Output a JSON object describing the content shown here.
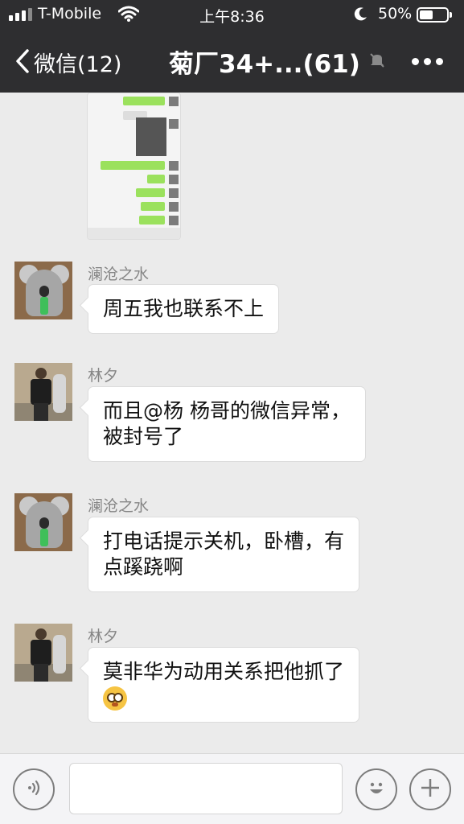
{
  "status_bar": {
    "carrier": "T-Mobile",
    "time": "上午8:36",
    "battery_percent": "50%",
    "battery_level": 0.5
  },
  "nav": {
    "back_label": "微信(12)",
    "title": "菊厂34+...(61)"
  },
  "messages": [
    {
      "sender": "澜沧之水",
      "avatar": "koala-avatar",
      "lines": [
        "周五我也联系不上"
      ]
    },
    {
      "sender": "林夕",
      "avatar": "person-avatar",
      "lines": [
        "而且@杨 杨哥的微信异常，",
        "被封号了"
      ]
    },
    {
      "sender": "澜沧之水",
      "avatar": "koala-avatar",
      "lines": [
        "打电话提示关机，卧槽，有",
        "点蹊跷啊"
      ]
    },
    {
      "sender": "林夕",
      "avatar": "person-avatar",
      "lines": [
        "莫非华为动用关系把他抓了"
      ],
      "emoji": "flushed-face-icon"
    }
  ],
  "icons": {
    "back": "chevron-left-icon",
    "muted": "bell-muted-icon",
    "more": "more-dots-icon",
    "voice": "voice-icon",
    "emoji": "smiley-icon",
    "plus": "plus-icon",
    "wifi": "wifi-icon",
    "moon": "moon-icon"
  },
  "colors": {
    "header_bg": "#2e2e30",
    "chat_bg": "#ebebeb",
    "bubble_bg": "#ffffff",
    "sender_text": "#858585"
  }
}
